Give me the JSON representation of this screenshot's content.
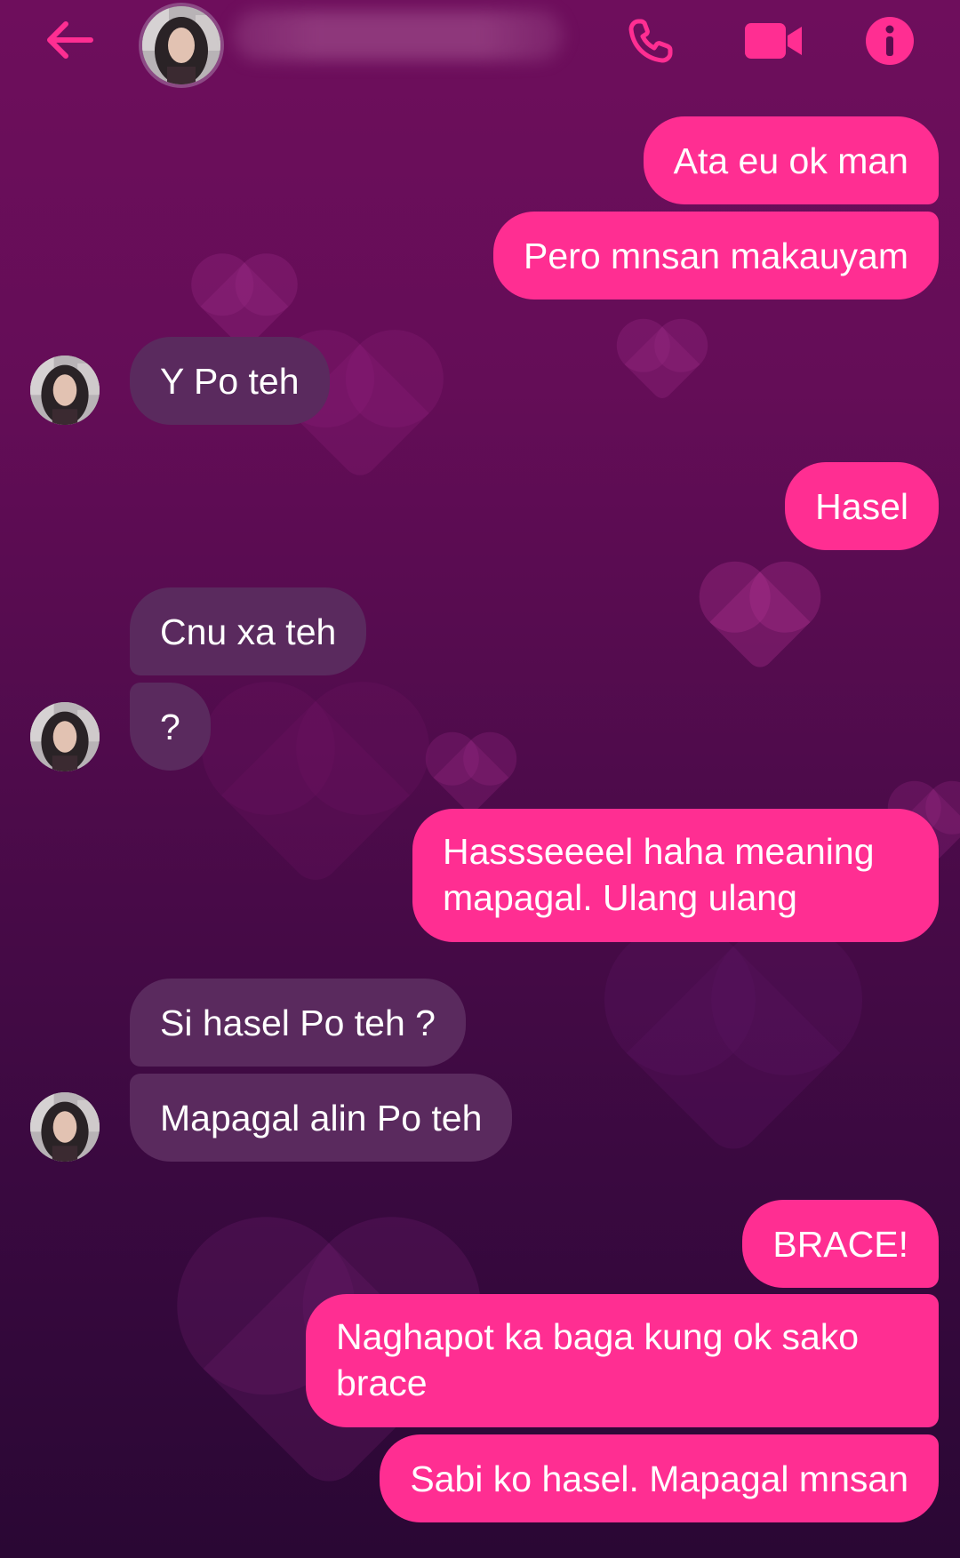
{
  "colors": {
    "accent": "#ff2e92",
    "incoming_bubble": "#5a2a5e",
    "background_top": "#6e0e5c",
    "background_bottom": "#2a0734"
  },
  "header": {
    "back_icon": "arrow-left-icon",
    "call_icon": "phone-icon",
    "video_icon": "video-camera-icon",
    "info_icon": "info-icon"
  },
  "messages": [
    {
      "from": "me",
      "text": "Ata eu ok man"
    },
    {
      "from": "me",
      "text": "Pero mnsan makauyam"
    },
    {
      "from": "them",
      "text": "Y Po teh"
    },
    {
      "from": "me",
      "text": "Hasel"
    },
    {
      "from": "them",
      "text": "Cnu xa teh"
    },
    {
      "from": "them",
      "text": "?"
    },
    {
      "from": "me",
      "text": "Hassseeeel haha meaning mapagal. Ulang ulang"
    },
    {
      "from": "them",
      "text": "Si hasel Po teh ?"
    },
    {
      "from": "them",
      "text": "Mapagal alin Po teh"
    },
    {
      "from": "me",
      "text": "BRACE!"
    },
    {
      "from": "me",
      "text": "Naghapot ka baga kung ok sako brace"
    },
    {
      "from": "me",
      "text": "Sabi ko hasel. Mapagal mnsan"
    }
  ]
}
